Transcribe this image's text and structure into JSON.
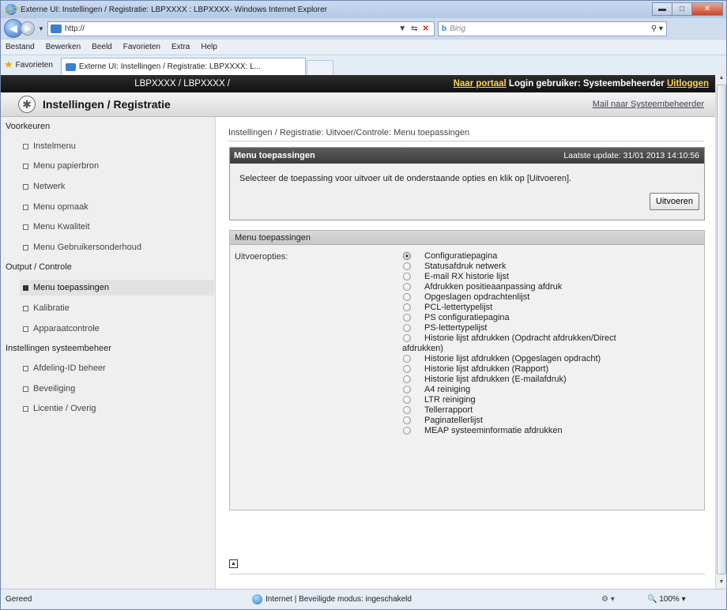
{
  "window": {
    "title": "Externe UI: Instellingen / Registratie: LBPXXXX : LBPXXXX- Windows Internet Explorer"
  },
  "browser": {
    "address": "http://",
    "search_placeholder": "Bing",
    "menu": [
      "Bestand",
      "Bewerken",
      "Beeld",
      "Favorieten",
      "Extra",
      "Help"
    ],
    "favorites_label": "Favorieten",
    "tab_title": "Externe UI: Instellingen / Registratie: LBPXXXX: L..."
  },
  "header": {
    "model": "LBPXXXX / LBPXXXX /",
    "portal_link": "Naar portaal",
    "login_label": "Login gebruiker: Systeembeheerder",
    "logout_link": "Uitloggen"
  },
  "subheader": {
    "title": "Instellingen / Registratie",
    "mail_link": "Mail naar Systeembeheerder"
  },
  "sidebar": {
    "sections": [
      {
        "label": "Voorkeuren",
        "items": [
          "Instelmenu",
          "Menu papierbron",
          "Netwerk",
          "Menu opmaak",
          "Menu Kwaliteit",
          "Menu Gebruikersonderhoud"
        ]
      },
      {
        "label": "Output / Controle",
        "items": [
          "Menu toepassingen",
          "Kalibratie",
          "Apparaatcontrole"
        ]
      },
      {
        "label": "Instellingen systeembeheer",
        "items": [
          "Afdeling-ID beheer",
          "Beveiliging",
          "Licentie / Overig"
        ]
      }
    ],
    "active_item": "Menu toepassingen"
  },
  "main": {
    "breadcrumb": "Instellingen / Registratie: Uitvoer/Controle: Menu toepassingen",
    "panel1": {
      "title": "Menu toepassingen",
      "last_update": "Laatste update: 31/01 2013 14:10:56",
      "message": "Selecteer de toepassing voor uitvoer uit de onderstaande opties en klik op [Uitvoeren].",
      "execute_button": "Uitvoeren"
    },
    "panel2": {
      "title": "Menu toepassingen",
      "field_label": "Uitvoeropties:",
      "options": [
        "Configuratiepagina",
        "Statusafdruk netwerk",
        "E-mail RX historie lijst",
        "Afdrukken positieaanpassing afdruk",
        "Opgeslagen opdrachtenlijst",
        "PCL-lettertypelijst",
        "PS configuratiepagina",
        "PS-lettertypelijst",
        "Historie lijst afdrukken (Opdracht afdrukken/Direct",
        "Historie lijst afdrukken (Opgeslagen opdracht)",
        "Historie lijst afdrukken (Rapport)",
        "Historie lijst afdrukken (E-mailafdruk)",
        "A4 reiniging",
        "LTR reiniging",
        "Tellerrapport",
        "Paginatellerlijst",
        "MEAP systeeminformatie afdrukken"
      ],
      "wrap_continuation": "afdrukken)",
      "selected_index": 0
    }
  },
  "statusbar": {
    "ready": "Gereed",
    "zone": "Internet | Beveiligde modus: ingeschakeld",
    "zoom": "100%"
  },
  "colors": {
    "header_bg": "#1c1c1c",
    "link_yellow": "#ffd44a",
    "panel_header": "#4a4a4a"
  }
}
